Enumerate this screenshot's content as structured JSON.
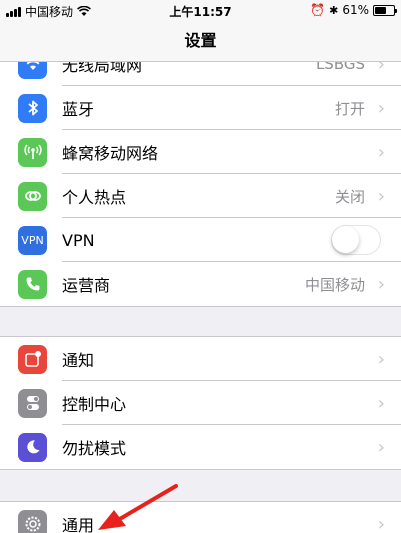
{
  "status_bar": {
    "carrier": "中国移动",
    "time": "上午11:57",
    "battery_percent": "61%",
    "battery_level": 0.61
  },
  "nav": {
    "title": "设置"
  },
  "groups": [
    {
      "rows": [
        {
          "label": "无线局域网",
          "value": "LSBGS",
          "icon": "wifi-icon",
          "color": "#2f7cf6"
        },
        {
          "label": "蓝牙",
          "value": "打开",
          "icon": "bluetooth-icon",
          "color": "#2f7cf6"
        },
        {
          "label": "蜂窝移动网络",
          "value": "",
          "icon": "cellular-icon",
          "color": "#5ac757"
        },
        {
          "label": "个人热点",
          "value": "关闭",
          "icon": "hotspot-icon",
          "color": "#5ac757"
        },
        {
          "label": "VPN",
          "value": "",
          "icon": "vpn-icon",
          "color": "#2f6fe0",
          "icon_text": "VPN",
          "toggle_on": false
        },
        {
          "label": "运营商",
          "value": "中国移动",
          "icon": "phone-icon",
          "color": "#5ac757"
        }
      ]
    },
    {
      "rows": [
        {
          "label": "通知",
          "value": "",
          "icon": "notifications-icon",
          "color": "#e9453a"
        },
        {
          "label": "控制中心",
          "value": "",
          "icon": "control-center-icon",
          "color": "#8e8e93"
        },
        {
          "label": "勿扰模式",
          "value": "",
          "icon": "moon-icon",
          "color": "#5b4fd6"
        }
      ]
    },
    {
      "rows": [
        {
          "label": "通用",
          "value": "",
          "icon": "gear-icon",
          "color": "#8e8e93"
        }
      ]
    }
  ],
  "annotation": {
    "icon": "red-arrow-annotation",
    "color": "#e8211c"
  }
}
